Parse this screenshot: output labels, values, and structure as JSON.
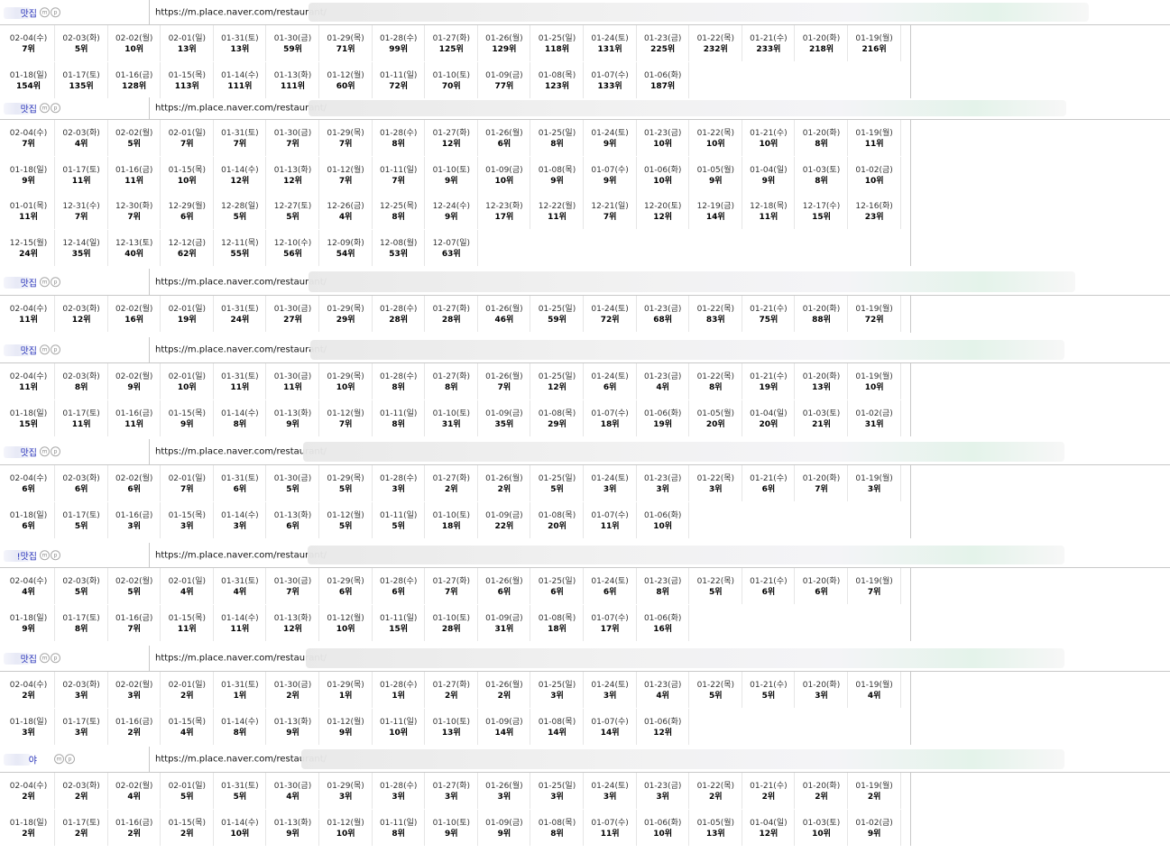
{
  "url_prefix": "https://m.place.naver.com/restaurant/",
  "groups": [
    {
      "keyword": "맛집",
      "badges": [
        "m",
        "p"
      ],
      "entries": [
        [
          "02-04(수)",
          "7위"
        ],
        [
          "02-03(화)",
          "5위"
        ],
        [
          "02-02(월)",
          "10위"
        ],
        [
          "02-01(일)",
          "13위"
        ],
        [
          "01-31(토)",
          "13위"
        ],
        [
          "01-30(금)",
          "59위"
        ],
        [
          "01-29(목)",
          "71위"
        ],
        [
          "01-28(수)",
          "99위"
        ],
        [
          "01-27(화)",
          "125위"
        ],
        [
          "01-26(월)",
          "129위"
        ],
        [
          "01-25(일)",
          "118위"
        ],
        [
          "01-24(토)",
          "131위"
        ],
        [
          "01-23(금)",
          "225위"
        ],
        [
          "01-22(목)",
          "232위"
        ],
        [
          "01-21(수)",
          "233위"
        ],
        [
          "01-20(화)",
          "218위"
        ],
        [
          "01-19(월)",
          "216위"
        ],
        [
          "01-18(일)",
          "154위"
        ],
        [
          "01-17(토)",
          "135위"
        ],
        [
          "01-16(금)",
          "128위"
        ],
        [
          "01-15(목)",
          "113위"
        ],
        [
          "01-14(수)",
          "111위"
        ],
        [
          "01-13(화)",
          "111위"
        ],
        [
          "01-12(월)",
          "60위"
        ],
        [
          "01-11(일)",
          "72위"
        ],
        [
          "01-10(토)",
          "70위"
        ],
        [
          "01-09(금)",
          "77위"
        ],
        [
          "01-08(목)",
          "123위"
        ],
        [
          "01-07(수)",
          "133위"
        ],
        [
          "01-06(화)",
          "187위"
        ]
      ]
    },
    {
      "keyword": "맛집",
      "badges": [
        "m",
        "p"
      ],
      "entries": [
        [
          "02-04(수)",
          "7위"
        ],
        [
          "02-03(화)",
          "4위"
        ],
        [
          "02-02(월)",
          "5위"
        ],
        [
          "02-01(일)",
          "7위"
        ],
        [
          "01-31(토)",
          "7위"
        ],
        [
          "01-30(금)",
          "7위"
        ],
        [
          "01-29(목)",
          "7위"
        ],
        [
          "01-28(수)",
          "8위"
        ],
        [
          "01-27(화)",
          "12위"
        ],
        [
          "01-26(월)",
          "6위"
        ],
        [
          "01-25(일)",
          "8위"
        ],
        [
          "01-24(토)",
          "9위"
        ],
        [
          "01-23(금)",
          "10위"
        ],
        [
          "01-22(목)",
          "10위"
        ],
        [
          "01-21(수)",
          "10위"
        ],
        [
          "01-20(화)",
          "8위"
        ],
        [
          "01-19(월)",
          "11위"
        ],
        [
          "01-18(일)",
          "9위"
        ],
        [
          "01-17(토)",
          "11위"
        ],
        [
          "01-16(금)",
          "11위"
        ],
        [
          "01-15(목)",
          "10위"
        ],
        [
          "01-14(수)",
          "12위"
        ],
        [
          "01-13(화)",
          "12위"
        ],
        [
          "01-12(월)",
          "7위"
        ],
        [
          "01-11(일)",
          "7위"
        ],
        [
          "01-10(토)",
          "9위"
        ],
        [
          "01-09(금)",
          "10위"
        ],
        [
          "01-08(목)",
          "9위"
        ],
        [
          "01-07(수)",
          "9위"
        ],
        [
          "01-06(화)",
          "10위"
        ],
        [
          "01-05(월)",
          "9위"
        ],
        [
          "01-04(일)",
          "9위"
        ],
        [
          "01-03(토)",
          "8위"
        ],
        [
          "01-02(금)",
          "10위"
        ],
        [
          "01-01(목)",
          "11위"
        ],
        [
          "12-31(수)",
          "7위"
        ],
        [
          "12-30(화)",
          "7위"
        ],
        [
          "12-29(월)",
          "6위"
        ],
        [
          "12-28(일)",
          "5위"
        ],
        [
          "12-27(토)",
          "5위"
        ],
        [
          "12-26(금)",
          "4위"
        ],
        [
          "12-25(목)",
          "8위"
        ],
        [
          "12-24(수)",
          "9위"
        ],
        [
          "12-23(화)",
          "17위"
        ],
        [
          "12-22(월)",
          "11위"
        ],
        [
          "12-21(일)",
          "7위"
        ],
        [
          "12-20(토)",
          "12위"
        ],
        [
          "12-19(금)",
          "14위"
        ],
        [
          "12-18(목)",
          "11위"
        ],
        [
          "12-17(수)",
          "15위"
        ],
        [
          "12-16(화)",
          "23위"
        ],
        [
          "12-15(월)",
          "24위"
        ],
        [
          "12-14(일)",
          "35위"
        ],
        [
          "12-13(토)",
          "40위"
        ],
        [
          "12-12(금)",
          "62위"
        ],
        [
          "12-11(목)",
          "55위"
        ],
        [
          "12-10(수)",
          "56위"
        ],
        [
          "12-09(화)",
          "54위"
        ],
        [
          "12-08(월)",
          "53위"
        ],
        [
          "12-07(일)",
          "63위"
        ]
      ]
    },
    {
      "keyword": "맛집",
      "badges": [
        "m",
        "p"
      ],
      "entries": [
        [
          "02-04(수)",
          "11위"
        ],
        [
          "02-03(화)",
          "12위"
        ],
        [
          "02-02(월)",
          "16위"
        ],
        [
          "02-01(일)",
          "19위"
        ],
        [
          "01-31(토)",
          "24위"
        ],
        [
          "01-30(금)",
          "27위"
        ],
        [
          "01-29(목)",
          "29위"
        ],
        [
          "01-28(수)",
          "28위"
        ],
        [
          "01-27(화)",
          "28위"
        ],
        [
          "01-26(월)",
          "46위"
        ],
        [
          "01-25(일)",
          "59위"
        ],
        [
          "01-24(토)",
          "72위"
        ],
        [
          "01-23(금)",
          "68위"
        ],
        [
          "01-22(목)",
          "83위"
        ],
        [
          "01-21(수)",
          "75위"
        ],
        [
          "01-20(화)",
          "88위"
        ],
        [
          "01-19(월)",
          "72위"
        ]
      ]
    },
    {
      "keyword": "맛집",
      "badges": [
        "m",
        "p"
      ],
      "entries": [
        [
          "02-04(수)",
          "11위"
        ],
        [
          "02-03(화)",
          "8위"
        ],
        [
          "02-02(월)",
          "9위"
        ],
        [
          "02-01(일)",
          "10위"
        ],
        [
          "01-31(토)",
          "11위"
        ],
        [
          "01-30(금)",
          "11위"
        ],
        [
          "01-29(목)",
          "10위"
        ],
        [
          "01-28(수)",
          "8위"
        ],
        [
          "01-27(화)",
          "8위"
        ],
        [
          "01-26(월)",
          "7위"
        ],
        [
          "01-25(일)",
          "12위"
        ],
        [
          "01-24(토)",
          "6위"
        ],
        [
          "01-23(금)",
          "4위"
        ],
        [
          "01-22(목)",
          "8위"
        ],
        [
          "01-21(수)",
          "19위"
        ],
        [
          "01-20(화)",
          "13위"
        ],
        [
          "01-19(월)",
          "10위"
        ],
        [
          "01-18(일)",
          "15위"
        ],
        [
          "01-17(토)",
          "11위"
        ],
        [
          "01-16(금)",
          "11위"
        ],
        [
          "01-15(목)",
          "9위"
        ],
        [
          "01-14(수)",
          "8위"
        ],
        [
          "01-13(화)",
          "9위"
        ],
        [
          "01-12(월)",
          "7위"
        ],
        [
          "01-11(일)",
          "8위"
        ],
        [
          "01-10(토)",
          "31위"
        ],
        [
          "01-09(금)",
          "35위"
        ],
        [
          "01-08(목)",
          "29위"
        ],
        [
          "01-07(수)",
          "18위"
        ],
        [
          "01-06(화)",
          "19위"
        ],
        [
          "01-05(월)",
          "20위"
        ],
        [
          "01-04(일)",
          "20위"
        ],
        [
          "01-03(토)",
          "21위"
        ],
        [
          "01-02(금)",
          "31위"
        ]
      ]
    },
    {
      "keyword": "맛집",
      "badges": [
        "m",
        "p"
      ],
      "entries": [
        [
          "02-04(수)",
          "6위"
        ],
        [
          "02-03(화)",
          "6위"
        ],
        [
          "02-02(월)",
          "6위"
        ],
        [
          "02-01(일)",
          "7위"
        ],
        [
          "01-31(토)",
          "6위"
        ],
        [
          "01-30(금)",
          "5위"
        ],
        [
          "01-29(목)",
          "5위"
        ],
        [
          "01-28(수)",
          "3위"
        ],
        [
          "01-27(화)",
          "2위"
        ],
        [
          "01-26(월)",
          "2위"
        ],
        [
          "01-25(일)",
          "5위"
        ],
        [
          "01-24(토)",
          "3위"
        ],
        [
          "01-23(금)",
          "3위"
        ],
        [
          "01-22(목)",
          "3위"
        ],
        [
          "01-21(수)",
          "6위"
        ],
        [
          "01-20(화)",
          "7위"
        ],
        [
          "01-19(월)",
          "3위"
        ],
        [
          "01-18(일)",
          "6위"
        ],
        [
          "01-17(토)",
          "5위"
        ],
        [
          "01-16(금)",
          "3위"
        ],
        [
          "01-15(목)",
          "3위"
        ],
        [
          "01-14(수)",
          "3위"
        ],
        [
          "01-13(화)",
          "6위"
        ],
        [
          "01-12(월)",
          "5위"
        ],
        [
          "01-11(일)",
          "5위"
        ],
        [
          "01-10(토)",
          "18위"
        ],
        [
          "01-09(금)",
          "22위"
        ],
        [
          "01-08(목)",
          "20위"
        ],
        [
          "01-07(수)",
          "11위"
        ],
        [
          "01-06(화)",
          "10위"
        ]
      ]
    },
    {
      "keyword": "!맛집",
      "badges": [
        "m",
        "p"
      ],
      "entries": [
        [
          "02-04(수)",
          "4위"
        ],
        [
          "02-03(화)",
          "5위"
        ],
        [
          "02-02(월)",
          "5위"
        ],
        [
          "02-01(일)",
          "4위"
        ],
        [
          "01-31(토)",
          "4위"
        ],
        [
          "01-30(금)",
          "7위"
        ],
        [
          "01-29(목)",
          "6위"
        ],
        [
          "01-28(수)",
          "6위"
        ],
        [
          "01-27(화)",
          "7위"
        ],
        [
          "01-26(월)",
          "6위"
        ],
        [
          "01-25(일)",
          "6위"
        ],
        [
          "01-24(토)",
          "6위"
        ],
        [
          "01-23(금)",
          "8위"
        ],
        [
          "01-22(목)",
          "5위"
        ],
        [
          "01-21(수)",
          "6위"
        ],
        [
          "01-20(화)",
          "6위"
        ],
        [
          "01-19(월)",
          "7위"
        ],
        [
          "01-18(일)",
          "9위"
        ],
        [
          "01-17(토)",
          "8위"
        ],
        [
          "01-16(금)",
          "7위"
        ],
        [
          "01-15(목)",
          "11위"
        ],
        [
          "01-14(수)",
          "11위"
        ],
        [
          "01-13(화)",
          "12위"
        ],
        [
          "01-12(월)",
          "10위"
        ],
        [
          "01-11(일)",
          "15위"
        ],
        [
          "01-10(토)",
          "28위"
        ],
        [
          "01-09(금)",
          "31위"
        ],
        [
          "01-08(목)",
          "18위"
        ],
        [
          "01-07(수)",
          "17위"
        ],
        [
          "01-06(화)",
          "16위"
        ]
      ]
    },
    {
      "keyword": "맛집",
      "badges": [
        "m",
        "p"
      ],
      "entries": [
        [
          "02-04(수)",
          "2위"
        ],
        [
          "02-03(화)",
          "3위"
        ],
        [
          "02-02(월)",
          "3위"
        ],
        [
          "02-01(일)",
          "2위"
        ],
        [
          "01-31(토)",
          "1위"
        ],
        [
          "01-30(금)",
          "2위"
        ],
        [
          "01-29(목)",
          "1위"
        ],
        [
          "01-28(수)",
          "1위"
        ],
        [
          "01-27(화)",
          "2위"
        ],
        [
          "01-26(월)",
          "2위"
        ],
        [
          "01-25(일)",
          "3위"
        ],
        [
          "01-24(토)",
          "3위"
        ],
        [
          "01-23(금)",
          "4위"
        ],
        [
          "01-22(목)",
          "5위"
        ],
        [
          "01-21(수)",
          "5위"
        ],
        [
          "01-20(화)",
          "3위"
        ],
        [
          "01-19(월)",
          "4위"
        ],
        [
          "01-18(일)",
          "3위"
        ],
        [
          "01-17(토)",
          "3위"
        ],
        [
          "01-16(금)",
          "2위"
        ],
        [
          "01-15(목)",
          "4위"
        ],
        [
          "01-14(수)",
          "8위"
        ],
        [
          "01-13(화)",
          "9위"
        ],
        [
          "01-12(월)",
          "9위"
        ],
        [
          "01-11(일)",
          "10위"
        ],
        [
          "01-10(토)",
          "13위"
        ],
        [
          "01-09(금)",
          "14위"
        ],
        [
          "01-08(목)",
          "14위"
        ],
        [
          "01-07(수)",
          "14위"
        ],
        [
          "01-06(화)",
          "12위"
        ]
      ]
    },
    {
      "keyword": "야",
      "badges": [
        "m",
        "p"
      ],
      "entries": [
        [
          "02-04(수)",
          "2위"
        ],
        [
          "02-03(화)",
          "2위"
        ],
        [
          "02-02(월)",
          "4위"
        ],
        [
          "02-01(일)",
          "5위"
        ],
        [
          "01-31(토)",
          "5위"
        ],
        [
          "01-30(금)",
          "4위"
        ],
        [
          "01-29(목)",
          "3위"
        ],
        [
          "01-28(수)",
          "3위"
        ],
        [
          "01-27(화)",
          "3위"
        ],
        [
          "01-26(월)",
          "3위"
        ],
        [
          "01-25(일)",
          "3위"
        ],
        [
          "01-24(토)",
          "3위"
        ],
        [
          "01-23(금)",
          "3위"
        ],
        [
          "01-22(목)",
          "2위"
        ],
        [
          "01-21(수)",
          "2위"
        ],
        [
          "01-20(화)",
          "2위"
        ],
        [
          "01-19(월)",
          "2위"
        ],
        [
          "01-18(일)",
          "2위"
        ],
        [
          "01-17(토)",
          "2위"
        ],
        [
          "01-16(금)",
          "2위"
        ],
        [
          "01-15(목)",
          "2위"
        ],
        [
          "01-14(수)",
          "10위"
        ],
        [
          "01-13(화)",
          "9위"
        ],
        [
          "01-12(월)",
          "10위"
        ],
        [
          "01-11(일)",
          "8위"
        ],
        [
          "01-10(토)",
          "9위"
        ],
        [
          "01-09(금)",
          "9위"
        ],
        [
          "01-08(목)",
          "8위"
        ],
        [
          "01-07(수)",
          "11위"
        ],
        [
          "01-06(화)",
          "10위"
        ],
        [
          "01-05(월)",
          "13위"
        ],
        [
          "01-04(일)",
          "12위"
        ],
        [
          "01-03(토)",
          "10위"
        ],
        [
          "01-02(금)",
          "9위"
        ]
      ]
    }
  ]
}
